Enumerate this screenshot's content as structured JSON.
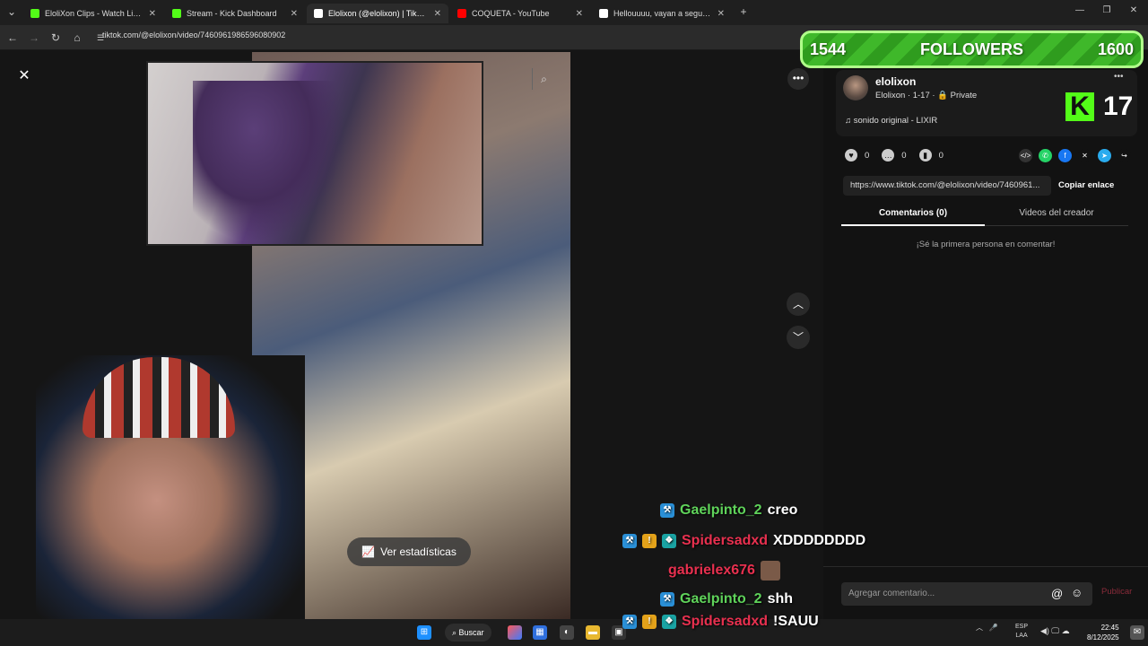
{
  "browser": {
    "tabs": [
      {
        "label": "EloliXon Clips - Watch Live on K",
        "favicon_color": "#53fc18",
        "active": false
      },
      {
        "label": "Stream - Kick Dashboard",
        "favicon_color": "#53fc18",
        "active": false
      },
      {
        "label": "Elolixon (@elolixon) | TikTok",
        "favicon_color": "#ffffff",
        "active": true
      },
      {
        "label": "COQUETA - YouTube",
        "favicon_color": "#ff0000",
        "active": false
      },
      {
        "label": "Hellouuuu, vayan a seguirme",
        "favicon_color": "#ffffff",
        "active": false
      }
    ],
    "new_tab": "+",
    "url": "tiktok.com/@elolixon/video/7460961986596080902"
  },
  "video": {
    "close": "✕",
    "more": "•••",
    "stats_button": "Ver estadísticas"
  },
  "sidebar": {
    "author_name": "elolixon",
    "author_meta": "Elolixon · 1-17 · 🔒 Private",
    "sound": "♫  sonido original - LIXIR",
    "likes": "0",
    "comments": "0",
    "saves": "0",
    "link": "https://www.tiktok.com/@elolixon/video/7460961...",
    "copy_link": "Copiar enlace",
    "tab_comments": "Comentarios (0)",
    "tab_creator": "Videos del creador",
    "empty_message": "¡Sé la primera persona en comentar!",
    "comment_placeholder": "Agregar comentario...",
    "publish": "Publicar"
  },
  "followers_goal": {
    "current": "1544",
    "label": "FOLLOWERS",
    "target": "1600"
  },
  "kick": {
    "logo": "K",
    "count": "17"
  },
  "chat": [
    {
      "user": "Gaelpinto_2",
      "user_color": "#5fd35a",
      "message": "creo"
    },
    {
      "user": "Spidersadxd",
      "user_color": "#e8304f",
      "message": "XDDDDDDDD"
    },
    {
      "user": "gabrielex676",
      "user_color": "#e8304f",
      "message": ""
    },
    {
      "user": "Gaelpinto_2",
      "user_color": "#5fd35a",
      "message": "shh"
    },
    {
      "user": "Spidersadxd",
      "user_color": "#e8304f",
      "message": "!SAUU"
    }
  ],
  "taskbar": {
    "search": "Buscar",
    "lang_top": "ESP",
    "lang_bottom": "LAA",
    "time": "22:45",
    "date": "8/12/2025"
  }
}
